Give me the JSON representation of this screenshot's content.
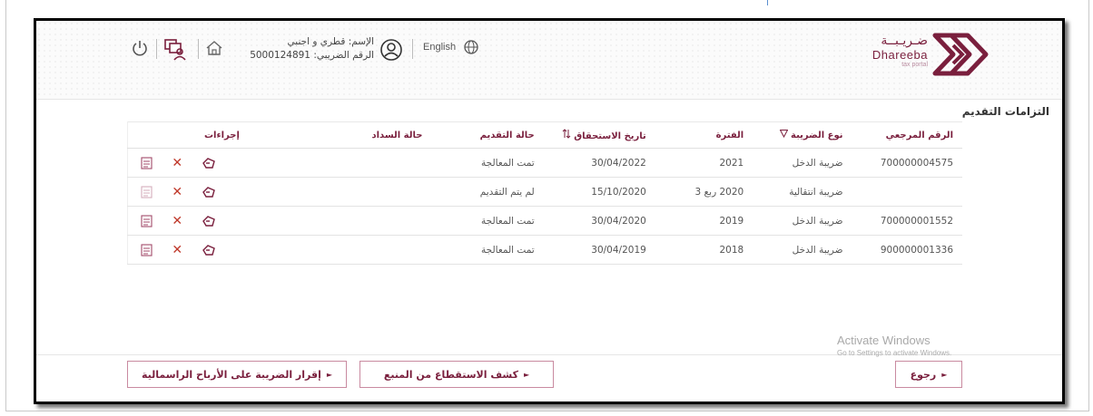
{
  "header": {
    "logo": {
      "arabic": "ضـريـبــة",
      "english": "Dhareeba",
      "tagline": "tax portal"
    },
    "user": {
      "name_line": "الإسم: قطري و اجنبي",
      "tax_id_line": "الرقم الضريبي: 5000124891"
    },
    "language_link": "English"
  },
  "section_title": "التزامات التقديم",
  "table": {
    "headers": {
      "reference": "الرقم المرجعي",
      "tax_type": "نوع الضريبة",
      "period": "الفترة",
      "due_date": "تاريخ الاستحقاق",
      "filing_status": "حالة التقديم",
      "payment_status": "حالة السداد",
      "actions": "إجراءات"
    },
    "rows": [
      {
        "reference": "700000004575",
        "tax_type": "ضريبة الدخل",
        "period": "2021",
        "due_date": "30/04/2022",
        "filing_status": "تمت المعالجة",
        "payment_status": ""
      },
      {
        "reference": "",
        "tax_type": "ضريبة انتقالية",
        "period": "2020 ربع 3",
        "due_date": "15/10/2020",
        "filing_status": "لم يتم التقديم",
        "payment_status": ""
      },
      {
        "reference": "700000001552",
        "tax_type": "ضريبة الدخل",
        "period": "2019",
        "due_date": "30/04/2020",
        "filing_status": "تمت المعالجة",
        "payment_status": ""
      },
      {
        "reference": "900000001336",
        "tax_type": "ضريبة الدخل",
        "period": "2018",
        "due_date": "30/04/2019",
        "filing_status": "تمت المعالجة",
        "payment_status": ""
      }
    ]
  },
  "footer": {
    "capital_gains_button": "إقرار الضريبة على الأرباح الراسمالية",
    "withholding_button": "كشف الاستقطاع من المنبع",
    "back_button": "رجوع"
  },
  "watermark": {
    "line1": "Activate Windows",
    "line2": "Go to Settings to activate Windows."
  },
  "colors": {
    "brand": "#7a1f3d",
    "late_date": "#c0392b"
  },
  "icons": [
    "power-icon",
    "profile-switch-icon",
    "home-icon",
    "user-icon",
    "globe-icon",
    "filter-icon",
    "sort-icon",
    "view-document-icon",
    "close-icon",
    "file-return-icon"
  ]
}
